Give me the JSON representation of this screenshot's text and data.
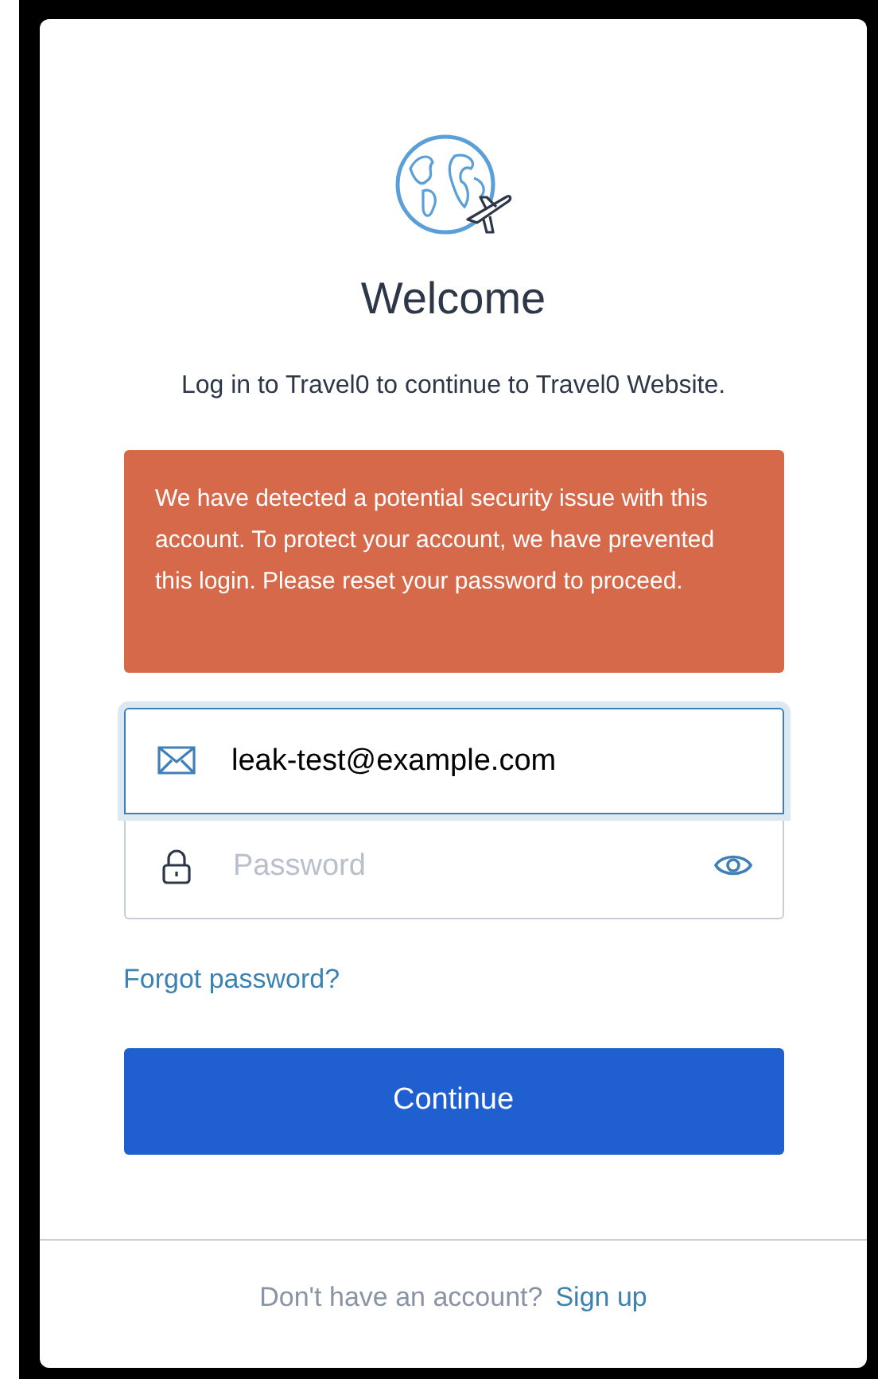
{
  "title": "Welcome",
  "subtitle": "Log in to Travel0 to continue to Travel0 Website.",
  "alert": "We have detected a potential security issue with this account. To protect your account, we have prevented this login. Please reset your password to proceed.",
  "email": {
    "value": "leak-test@example.com",
    "focused": true
  },
  "password": {
    "placeholder": "Password",
    "focused": false
  },
  "forgot_link": "Forgot password?",
  "continue_button": "Continue",
  "footer": {
    "text": "Don't have an account?",
    "link": "Sign up"
  }
}
